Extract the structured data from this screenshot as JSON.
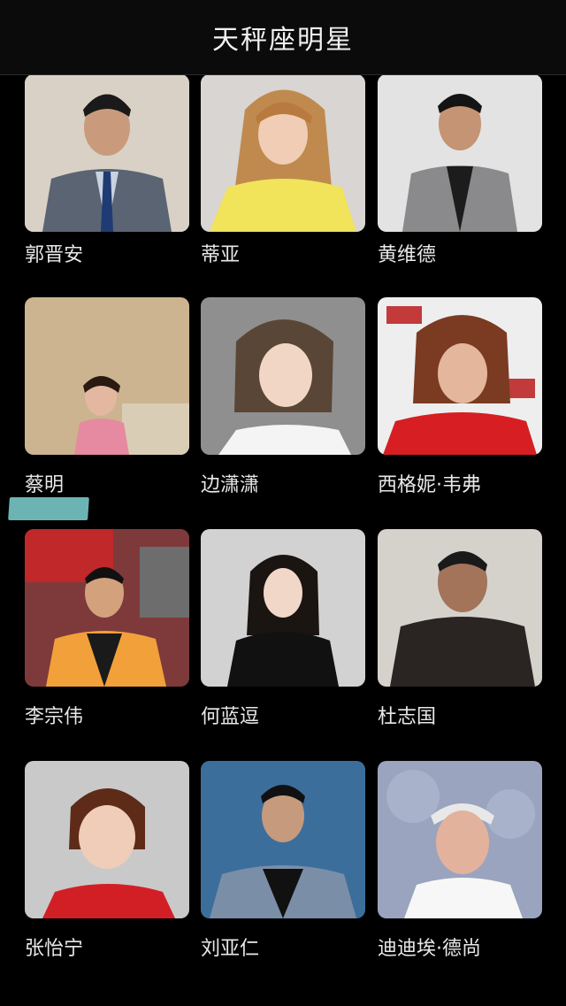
{
  "header": {
    "title": "天秤座明星"
  },
  "celebrities": [
    {
      "name": "郭晋安"
    },
    {
      "name": "蒂亚"
    },
    {
      "name": "黄维德"
    },
    {
      "name": "蔡明"
    },
    {
      "name": "边潇潇"
    },
    {
      "name": "西格妮·韦弗"
    },
    {
      "name": "李宗伟"
    },
    {
      "name": "何蓝逗"
    },
    {
      "name": "杜志国"
    },
    {
      "name": "张怡宁"
    },
    {
      "name": "刘亚仁"
    },
    {
      "name": "迪迪埃·德尚"
    }
  ],
  "colors": {
    "background": "#000000",
    "header_bg": "#0b0b0b",
    "highlight": "#7fd3d3"
  }
}
